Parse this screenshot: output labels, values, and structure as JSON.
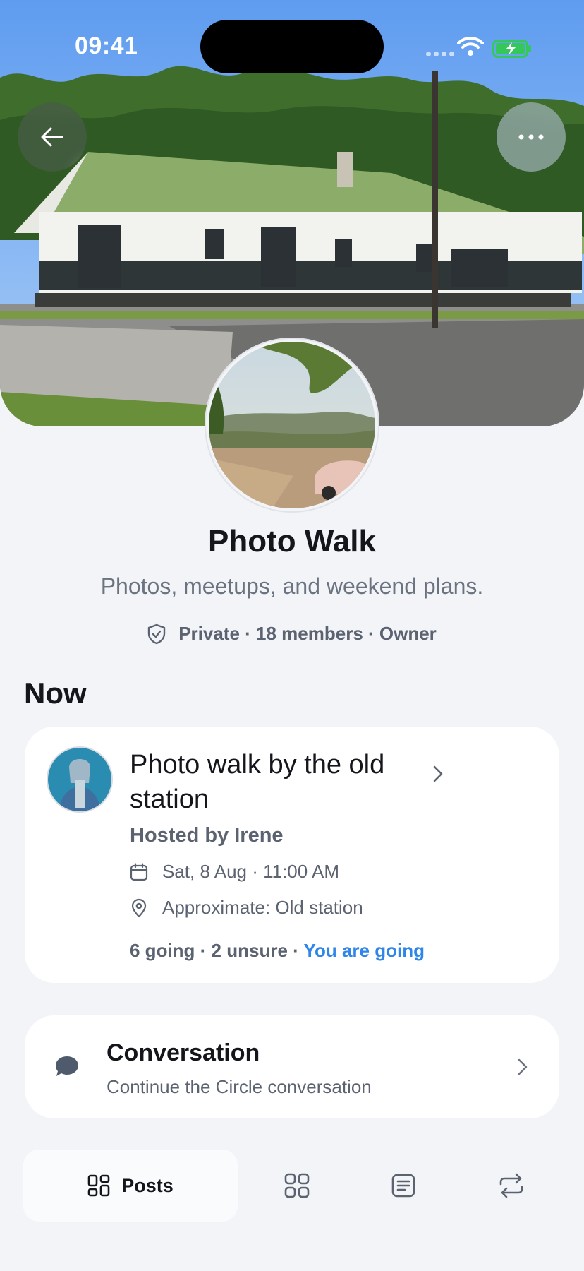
{
  "status_bar": {
    "time": "09:41"
  },
  "header": {
    "back_icon": "arrow-left-icon",
    "more_icon": "ellipsis-icon"
  },
  "group": {
    "title": "Photo Walk",
    "subtitle": "Photos, meetups, and weekend plans.",
    "privacy_icon": "shield-check-icon",
    "meta": "Private · 18 members · Owner"
  },
  "now_section": {
    "title": "Now",
    "event": {
      "title": "Photo walk by the old station",
      "host": "Hosted by Irene",
      "date": "Sat, 8 Aug · 11:00 AM",
      "location": "Approximate: Old station",
      "counts": "6 going · 2 unsure · ",
      "rsvp": "You are going",
      "rsvp_color": "#2f86e8"
    }
  },
  "conversation": {
    "title": "Conversation",
    "subtitle": "Continue the Circle conversation",
    "icon": "chat-bubble-icon"
  },
  "tabs": [
    {
      "label": "Posts",
      "icon": "posts-grid-icon",
      "active": true
    },
    {
      "label": "",
      "icon": "apps-grid-icon",
      "active": false
    },
    {
      "label": "",
      "icon": "document-list-icon",
      "active": false
    },
    {
      "label": "",
      "icon": "repeat-icon",
      "active": false
    }
  ],
  "colors": {
    "accent": "#2f86e8",
    "background": "#f3f4f8",
    "card": "#ffffff"
  }
}
